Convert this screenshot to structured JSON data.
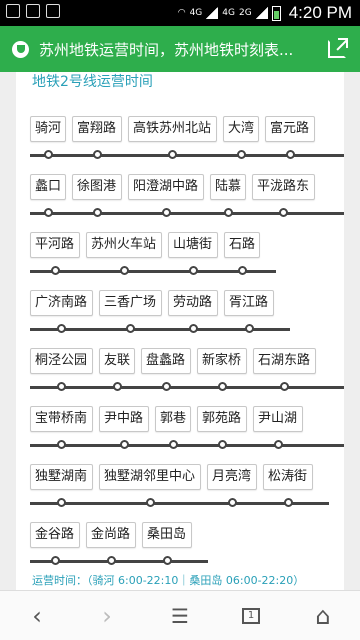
{
  "statusbar": {
    "signal_a": "4G",
    "signal_b": "4G",
    "signal_c": "2G",
    "time": "4:20 PM"
  },
  "titlebar": {
    "title": "苏州地铁运营时间，苏州地铁时刻表..."
  },
  "content": {
    "heading": "地铁2号线运营时间",
    "rows": [
      {
        "stations": [
          "骑河",
          "富翔路",
          "高铁苏州北站",
          "大湾",
          "富元路"
        ]
      },
      {
        "stations": [
          "蠡口",
          "徐图港",
          "阳澄湖中路",
          "陆慕",
          "平泷路东"
        ]
      },
      {
        "stations": [
          "平河路",
          "苏州火车站",
          "山塘街",
          "石路"
        ]
      },
      {
        "stations": [
          "广济南路",
          "三香广场",
          "劳动路",
          "胥江路"
        ]
      },
      {
        "stations": [
          "桐泾公园",
          "友联",
          "盘蠡路",
          "新家桥",
          "石湖东路"
        ]
      },
      {
        "stations": [
          "宝带桥南",
          "尹中路",
          "郭巷",
          "郭苑路",
          "尹山湖"
        ]
      },
      {
        "stations": [
          "独墅湖南",
          "独墅湖邻里中心",
          "月亮湾",
          "松涛街"
        ]
      },
      {
        "stations": [
          "金谷路",
          "金尚路",
          "桑田岛"
        ]
      }
    ],
    "hours": "运营时间：（骑河 6:00-22:10｜桑田岛 06:00-22:20）"
  },
  "colors": {
    "accent": "#2eae4c",
    "heading": "#2aa0b8",
    "line": "#444444"
  },
  "bottomnav": {
    "icons": [
      "back-icon",
      "forward-icon",
      "menu-icon",
      "tabs-icon",
      "home-icon"
    ],
    "tabs_count": "1"
  }
}
